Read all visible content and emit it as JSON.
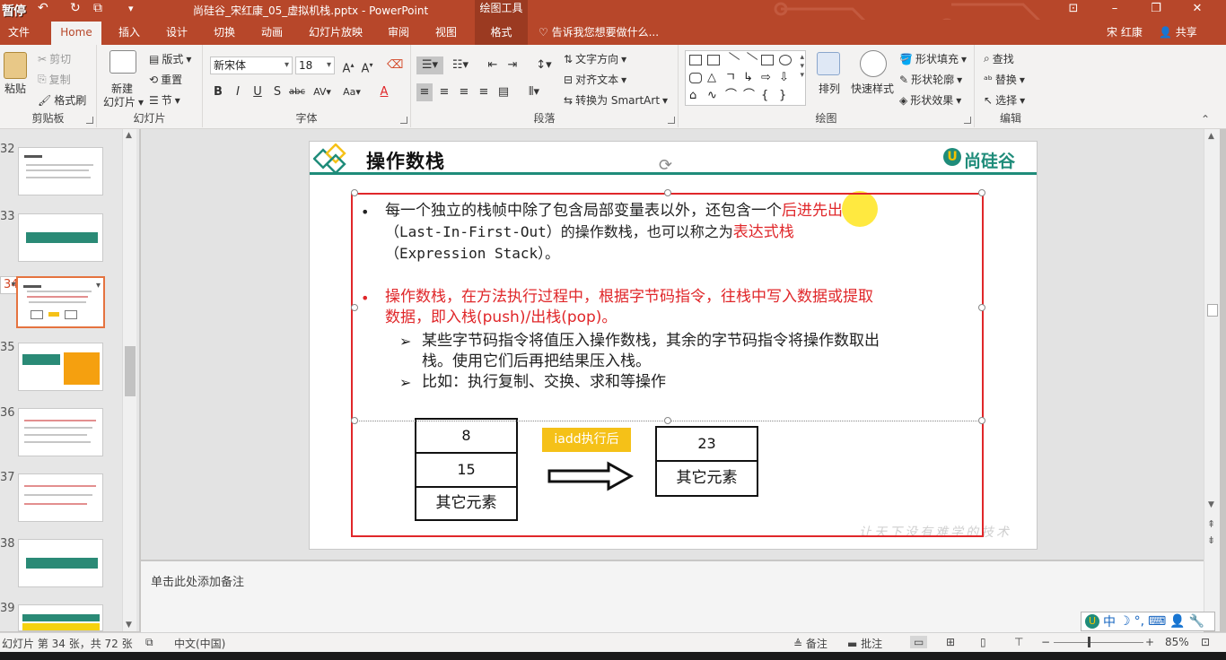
{
  "titlebar": {
    "pause_label": "暂停",
    "document_title": "尚硅谷_宋红康_05_虚拟机栈.pptx - PowerPoint",
    "context_label": "绘图工具"
  },
  "tabs": [
    "文件",
    "Home",
    "插入",
    "设计",
    "切换",
    "动画",
    "幻灯片放映",
    "审阅",
    "视图",
    "格式"
  ],
  "tell_me": "告诉我您想要做什么...",
  "user": "宋 红康",
  "share_label": "共享",
  "ribbon": {
    "clipboard": {
      "paste": "粘贴",
      "cut": "剪切",
      "copy": "复制",
      "format_painter": "格式刷",
      "label": "剪贴板"
    },
    "slides": {
      "new_slide": "新建",
      "new_slide_sub": "幻灯片",
      "layout": "版式",
      "reset": "重置",
      "section": "节",
      "label": "幻灯片"
    },
    "font": {
      "name": "新宋体",
      "size": "18",
      "label": "字体"
    },
    "paragraph": {
      "text_direction": "文字方向",
      "align_text": "对齐文本",
      "smartart": "转换为 SmartArt",
      "label": "段落"
    },
    "drawing": {
      "arrange": "排列",
      "quick_styles": "快速样式",
      "shape_fill": "形状填充",
      "shape_outline": "形状轮廓",
      "shape_effects": "形状效果",
      "label": "绘图"
    },
    "editing": {
      "find": "查找",
      "replace": "替换",
      "select": "选择",
      "label": "编辑"
    }
  },
  "thumbnails": [
    {
      "num": "32",
      "selected": false
    },
    {
      "num": "33",
      "selected": false
    },
    {
      "num": "34",
      "selected": true
    },
    {
      "num": "35",
      "selected": false
    },
    {
      "num": "36",
      "selected": false
    },
    {
      "num": "37",
      "selected": false
    },
    {
      "num": "38",
      "selected": false
    },
    {
      "num": "39",
      "selected": false
    }
  ],
  "slide": {
    "title": "操作数栈",
    "logo": "尚硅谷",
    "b1_line1_a": "每一个独立的栈帧中除了包含局部变量表以外，还包含一个",
    "b1_line1_red": "后进先出",
    "b1_line2_a": "（Last-In-First-Out）的操作数栈，也可以称之为",
    "b1_line2_red": "表达式栈",
    "b1_line3": "（Expression Stack）。",
    "b2_line1": "操作数栈，在方法执行过程中，根据字节码指令，往栈中写入数据或提取",
    "b2_line2": "数据，即入栈(push)/出栈(pop)。",
    "sub1_line1": "某些字节码指令将值压入操作数栈，其余的字节码指令将操作数取出",
    "sub1_line2": "栈。使用它们后再把结果压入栈。",
    "sub2": "比如：执行复制、交换、求和等操作",
    "stack_before": [
      "8",
      "15",
      "其它元素"
    ],
    "iadd_label": "iadd执行后",
    "stack_after": [
      "23",
      "其它元素"
    ],
    "watermark": "让天下没有难学的技术"
  },
  "notes_placeholder": "单击此处添加备注",
  "status": {
    "slide_info": "幻灯片 第 34 张，共 72 张",
    "language": "中文(中国)",
    "notes": "备注",
    "comments": "批注",
    "zoom": "85%"
  },
  "ime": {
    "mode": "中"
  }
}
